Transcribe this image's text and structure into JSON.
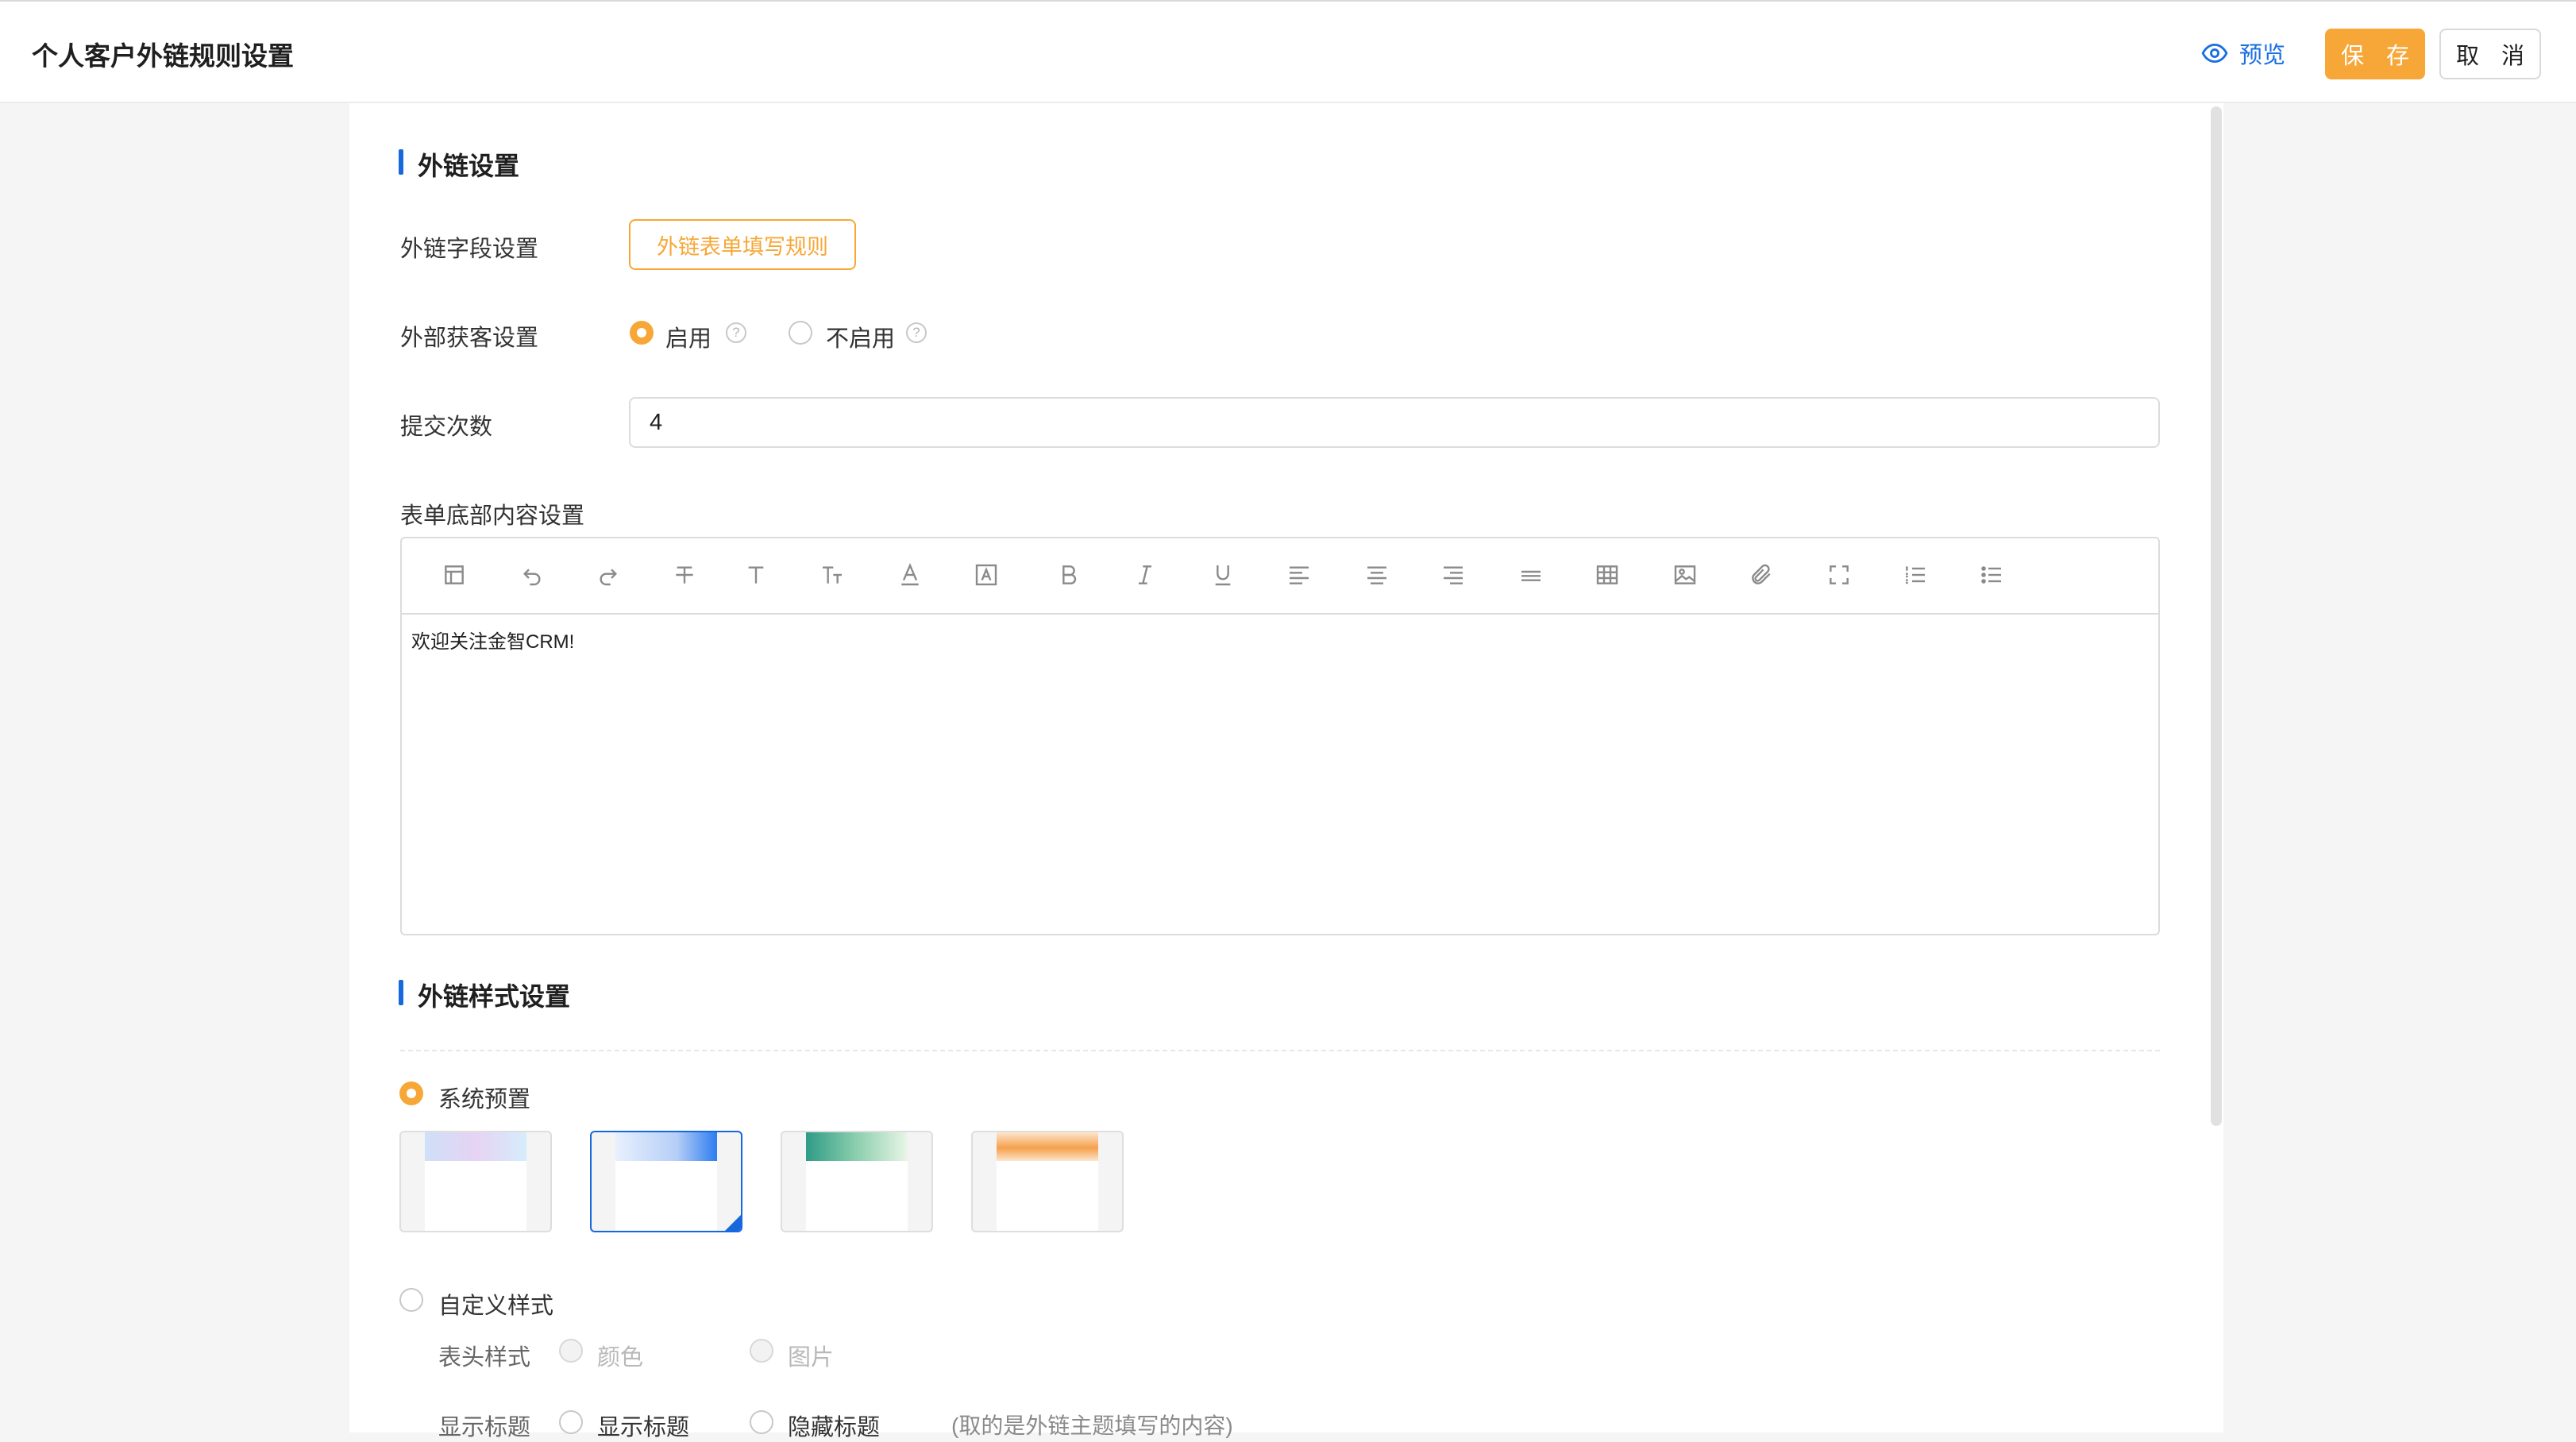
{
  "header": {
    "title": "个人客户外链规则设置",
    "preview_label": "预览",
    "save_label": "保 存",
    "cancel_label": "取 消"
  },
  "colors": {
    "accent": "#f7a737",
    "primary": "#1668dc",
    "link": "#1a6fe0"
  },
  "link_settings": {
    "section_title": "外链设置",
    "field_settings": {
      "label": "外链字段设置",
      "button_label": "外链表单填写规则"
    },
    "external_acquisition": {
      "label": "外部获客设置",
      "options": [
        {
          "label": "启用",
          "selected": true,
          "help_icon": "question-circle-icon"
        },
        {
          "label": "不启用",
          "selected": false,
          "help_icon": "question-circle-icon"
        }
      ]
    },
    "submit_count": {
      "label": "提交次数",
      "value": "4"
    },
    "footer_content": {
      "label": "表单底部内容设置",
      "toolbar": [
        "template-icon",
        "undo-icon",
        "redo-icon",
        "strikethrough-icon",
        "text-icon",
        "font-size-icon",
        "font-color-icon",
        "background-color-icon",
        "bold-icon",
        "italic-icon",
        "underline-icon",
        "align-left-icon",
        "align-center-icon",
        "align-right-icon",
        "horizontal-rule-icon",
        "table-icon",
        "image-icon",
        "attachment-icon",
        "fullscreen-icon",
        "ordered-list-icon",
        "unordered-list-icon"
      ],
      "content": "欢迎关注金智CRM!"
    }
  },
  "style_settings": {
    "section_title": "外链样式设置",
    "system_preset": {
      "label": "系统预置",
      "selected": true,
      "selected_theme": 1,
      "themes": [
        {
          "name": "theme-purple-blue",
          "colors": [
            "#cfe0f8",
            "#e6d3f3",
            "#d6ecfb"
          ]
        },
        {
          "name": "theme-blue",
          "colors": [
            "#e8f0fd",
            "#b6cff7",
            "#2e7df0"
          ]
        },
        {
          "name": "theme-green",
          "colors": [
            "#2f9b86",
            "#8ccfae",
            "#e9f5e7"
          ]
        },
        {
          "name": "theme-orange",
          "colors": [
            "#fde5cc",
            "#f5a04d",
            "#fde5cc"
          ]
        }
      ]
    },
    "custom_style": {
      "label": "自定义样式",
      "selected": false,
      "header_style": {
        "label": "表头样式",
        "options": [
          "颜色",
          "图片"
        ]
      },
      "show_title": {
        "label": "显示标题",
        "options": [
          "显示标题",
          "隐藏标题"
        ],
        "note": "(取的是外链主题填写的内容)"
      }
    }
  }
}
